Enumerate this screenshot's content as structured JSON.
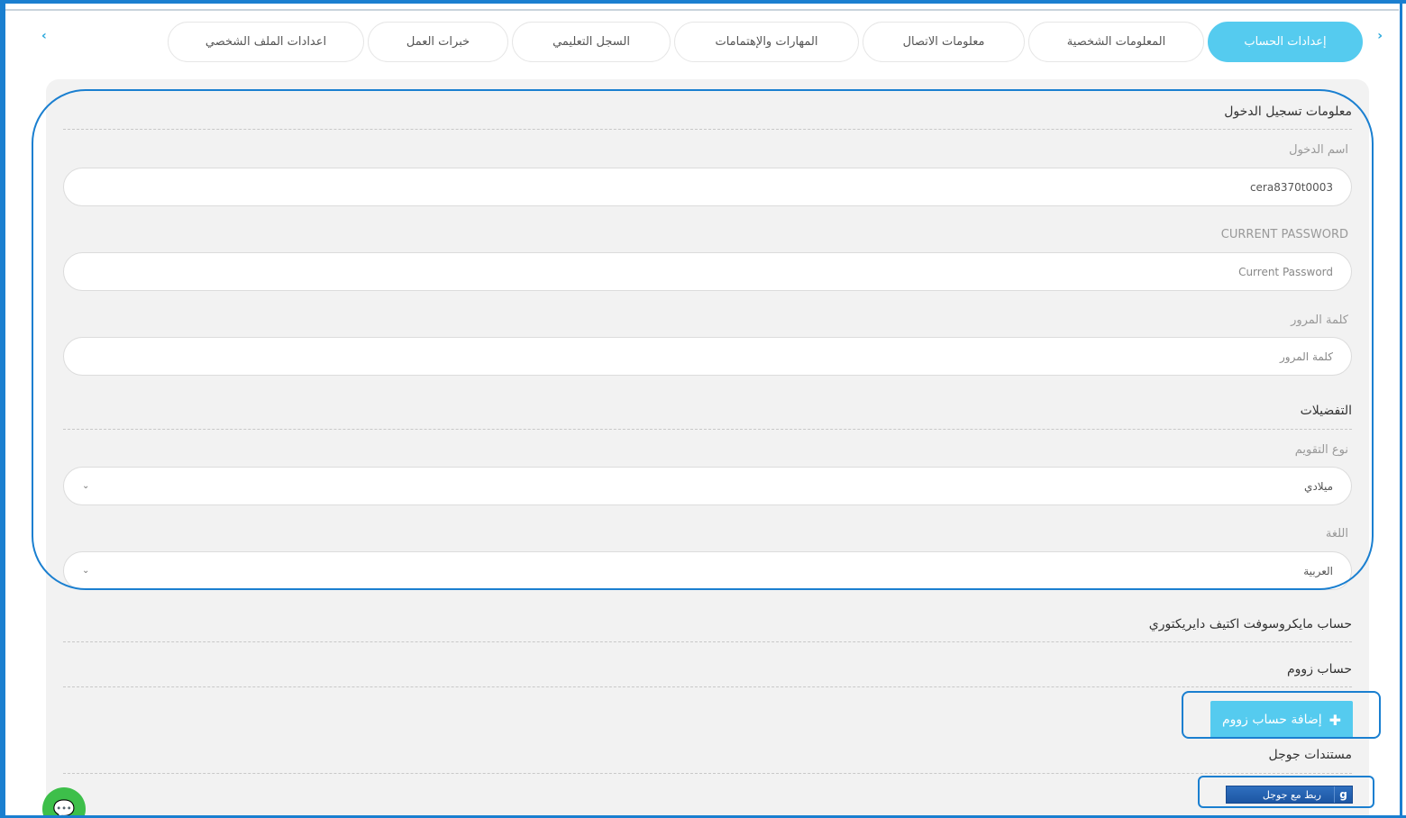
{
  "tabs": [
    {
      "label": "إعدادات الحساب",
      "active": true
    },
    {
      "label": "المعلومات الشخصية",
      "active": false
    },
    {
      "label": "معلومات الاتصال",
      "active": false
    },
    {
      "label": "المهارات والإهتمامات",
      "active": false
    },
    {
      "label": "السجل التعليمي",
      "active": false
    },
    {
      "label": "خبرات العمل",
      "active": false
    },
    {
      "label": "اعدادات الملف الشخصي",
      "active": false
    }
  ],
  "login": {
    "section_title": "معلومات تسجيل الدخول",
    "username_label": "اسم الدخول",
    "username_value": "cera8370t0003",
    "current_password_label": "CURRENT PASSWORD",
    "current_password_placeholder": "Current Password",
    "password_label": "كلمة المرور",
    "password_placeholder": "كلمة المرور"
  },
  "preferences": {
    "section_title": "التفضيلات",
    "calendar_label": "نوع التقويم",
    "calendar_value": "ميلادي",
    "language_label": "اللغة",
    "language_value": "العربية"
  },
  "accounts": {
    "microsoft_title": "حساب مايكروسوفت اكتيف دايريكتوري",
    "zoom_title": "حساب زووم",
    "zoom_button": "إضافة حساب زووم",
    "google_title": "مستندات جوجل",
    "google_button": "ربط مع جوجل",
    "google_icon_letter": "g"
  },
  "colors": {
    "accent": "#55cbef",
    "highlight": "#1a7fd0"
  }
}
